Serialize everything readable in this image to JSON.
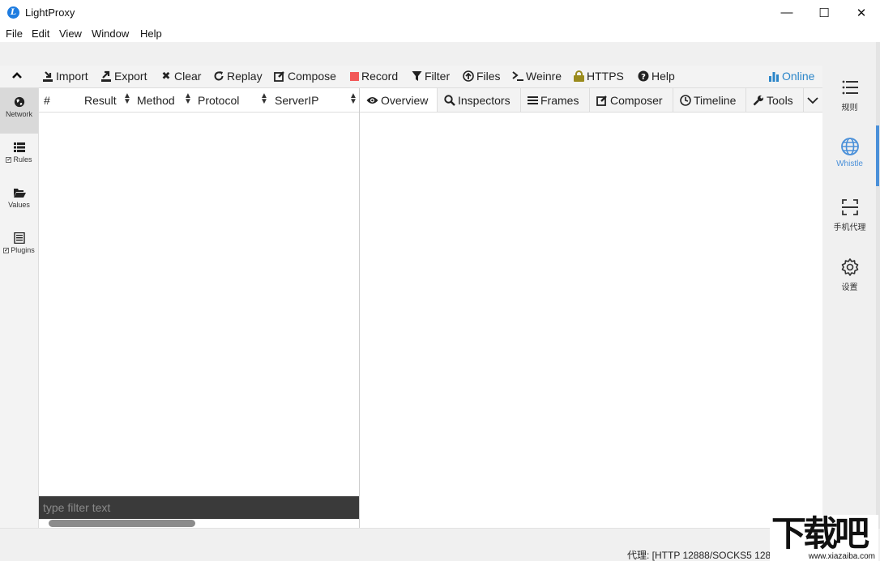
{
  "window": {
    "title": "LightProxy",
    "logo_letter": "L",
    "minimize": "—",
    "maximize": "☐",
    "close": "✕"
  },
  "menu": [
    "File",
    "Edit",
    "View",
    "Window",
    "Help"
  ],
  "toolbar": {
    "items": [
      "Import",
      "Export",
      "Clear",
      "Replay",
      "Compose",
      "Record",
      "Filter",
      "Files",
      "Weinre",
      "HTTPS",
      "Help"
    ],
    "status": "Online",
    "collapse_icon": "chevron-up-icon",
    "colors": {
      "record": "#f25858",
      "https_lock": "#9a8b1d",
      "online": "#2b86c9"
    }
  },
  "leftnav": {
    "items": [
      {
        "label": "Network",
        "icon": "globe-icon",
        "checked": null
      },
      {
        "label": "Rules",
        "icon": "list-icon",
        "checked": true
      },
      {
        "label": "Values",
        "icon": "folder-open-icon",
        "checked": null
      },
      {
        "label": "Plugins",
        "icon": "list-alt-icon",
        "checked": true
      }
    ]
  },
  "list": {
    "columns": [
      "#",
      "Result",
      "Method",
      "Protocol",
      "ServerIP"
    ],
    "filter_placeholder": "type filter text",
    "rows": []
  },
  "tabs": [
    "Overview",
    "Inspectors",
    "Frames",
    "Composer",
    "Timeline",
    "Tools"
  ],
  "rightbar": {
    "items": [
      {
        "label": "规则",
        "icon": "rules-list-icon"
      },
      {
        "label": "Whistle",
        "icon": "globe-icon",
        "active": true
      },
      {
        "label": "手机代理",
        "icon": "scan-icon"
      },
      {
        "label": "设置",
        "icon": "gear-icon"
      }
    ],
    "accent": "#4a90d9"
  },
  "status": {
    "proxy_text": "代理: [HTTP 12888/SOCKS5 12889"
  },
  "watermark": {
    "text": "下载吧",
    "url": "www.xiazaiba.com"
  }
}
